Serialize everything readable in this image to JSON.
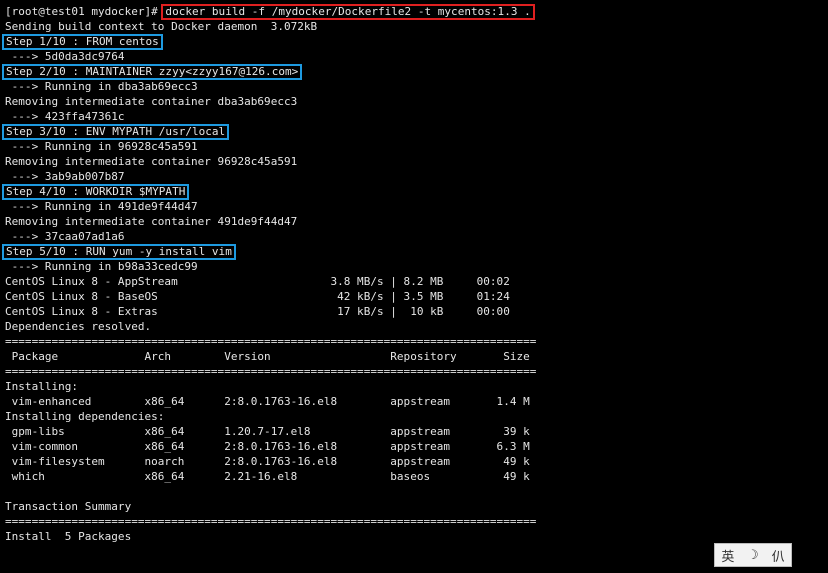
{
  "terminal": {
    "prompt": "[root@test01 mydocker]# ",
    "command": "docker build -f /mydocker/Dockerfile2 -t mycentos:1.3 .",
    "lines": [
      "Sending build context to Docker daemon  3.072kB",
      "Step 1/10 : FROM centos",
      " ---> 5d0da3dc9764",
      "Step 2/10 : MAINTAINER zzyy<zzyy167@126.com>",
      " ---> Running in dba3ab69ecc3",
      "Removing intermediate container dba3ab69ecc3",
      " ---> 423ffa47361c",
      "Step 3/10 : ENV MYPATH /usr/local",
      " ---> Running in 96928c45a591",
      "Removing intermediate container 96928c45a591",
      " ---> 3ab9ab007b87",
      "Step 4/10 : WORKDIR $MYPATH",
      " ---> Running in 491de9f44d47",
      "Removing intermediate container 491de9f44d47",
      " ---> 37caa07ad1a6",
      "Step 5/10 : RUN yum -y install vim",
      " ---> Running in b98a33cedc99",
      "CentOS Linux 8 - AppStream                       3.8 MB/s | 8.2 MB     00:02",
      "CentOS Linux 8 - BaseOS                           42 kB/s | 3.5 MB     01:24",
      "CentOS Linux 8 - Extras                           17 kB/s |  10 kB     00:00",
      "Dependencies resolved.",
      "================================================================================",
      " Package             Arch        Version                  Repository       Size",
      "================================================================================",
      "Installing:",
      " vim-enhanced        x86_64      2:8.0.1763-16.el8        appstream       1.4 M",
      "Installing dependencies:",
      " gpm-libs            x86_64      1.20.7-17.el8            appstream        39 k",
      " vim-common          x86_64      2:8.0.1763-16.el8        appstream       6.3 M",
      " vim-filesystem      noarch      2:8.0.1763-16.el8        appstream        49 k",
      " which               x86_64      2.21-16.el8              baseos           49 k",
      "",
      "Transaction Summary",
      "================================================================================",
      "Install  5 Packages"
    ]
  },
  "ime": {
    "lang": "英",
    "moon": "☽",
    "mode": "仈"
  }
}
